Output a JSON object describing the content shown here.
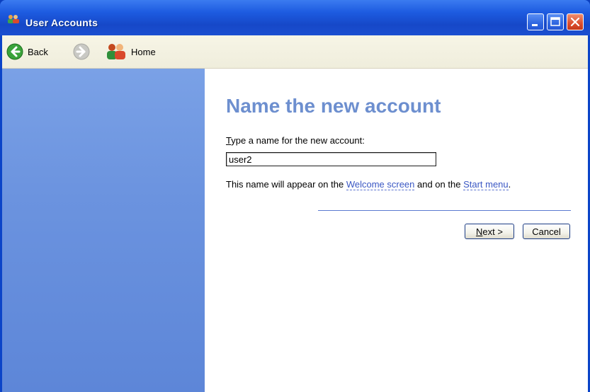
{
  "window": {
    "title": "User Accounts"
  },
  "toolbar": {
    "back_label": "Back",
    "forward_label": "",
    "home_label": "Home"
  },
  "content": {
    "heading": "Name the new account",
    "prompt_first": "T",
    "prompt_rest": "ype a name for the new account:",
    "name_value": "user2",
    "info_prefix": "This name will appear on the ",
    "link_welcome": "Welcome screen",
    "info_middle": " and on the ",
    "link_start": "Start menu",
    "info_suffix": ".",
    "next_first": "N",
    "next_rest": "ext >",
    "cancel_label": "Cancel"
  },
  "icons": {
    "app": "user-accounts-icon",
    "back": "back-arrow-icon",
    "forward": "forward-arrow-icon",
    "home": "home-users-icon",
    "minimize": "minimize-icon",
    "maximize": "maximize-icon",
    "close": "close-icon"
  },
  "colors": {
    "title_bar": "#1d5be0",
    "left_pane": "#6b93df",
    "heading": "#6d8fcf",
    "link": "#3a57c4",
    "close_button": "#dc4e2e"
  }
}
